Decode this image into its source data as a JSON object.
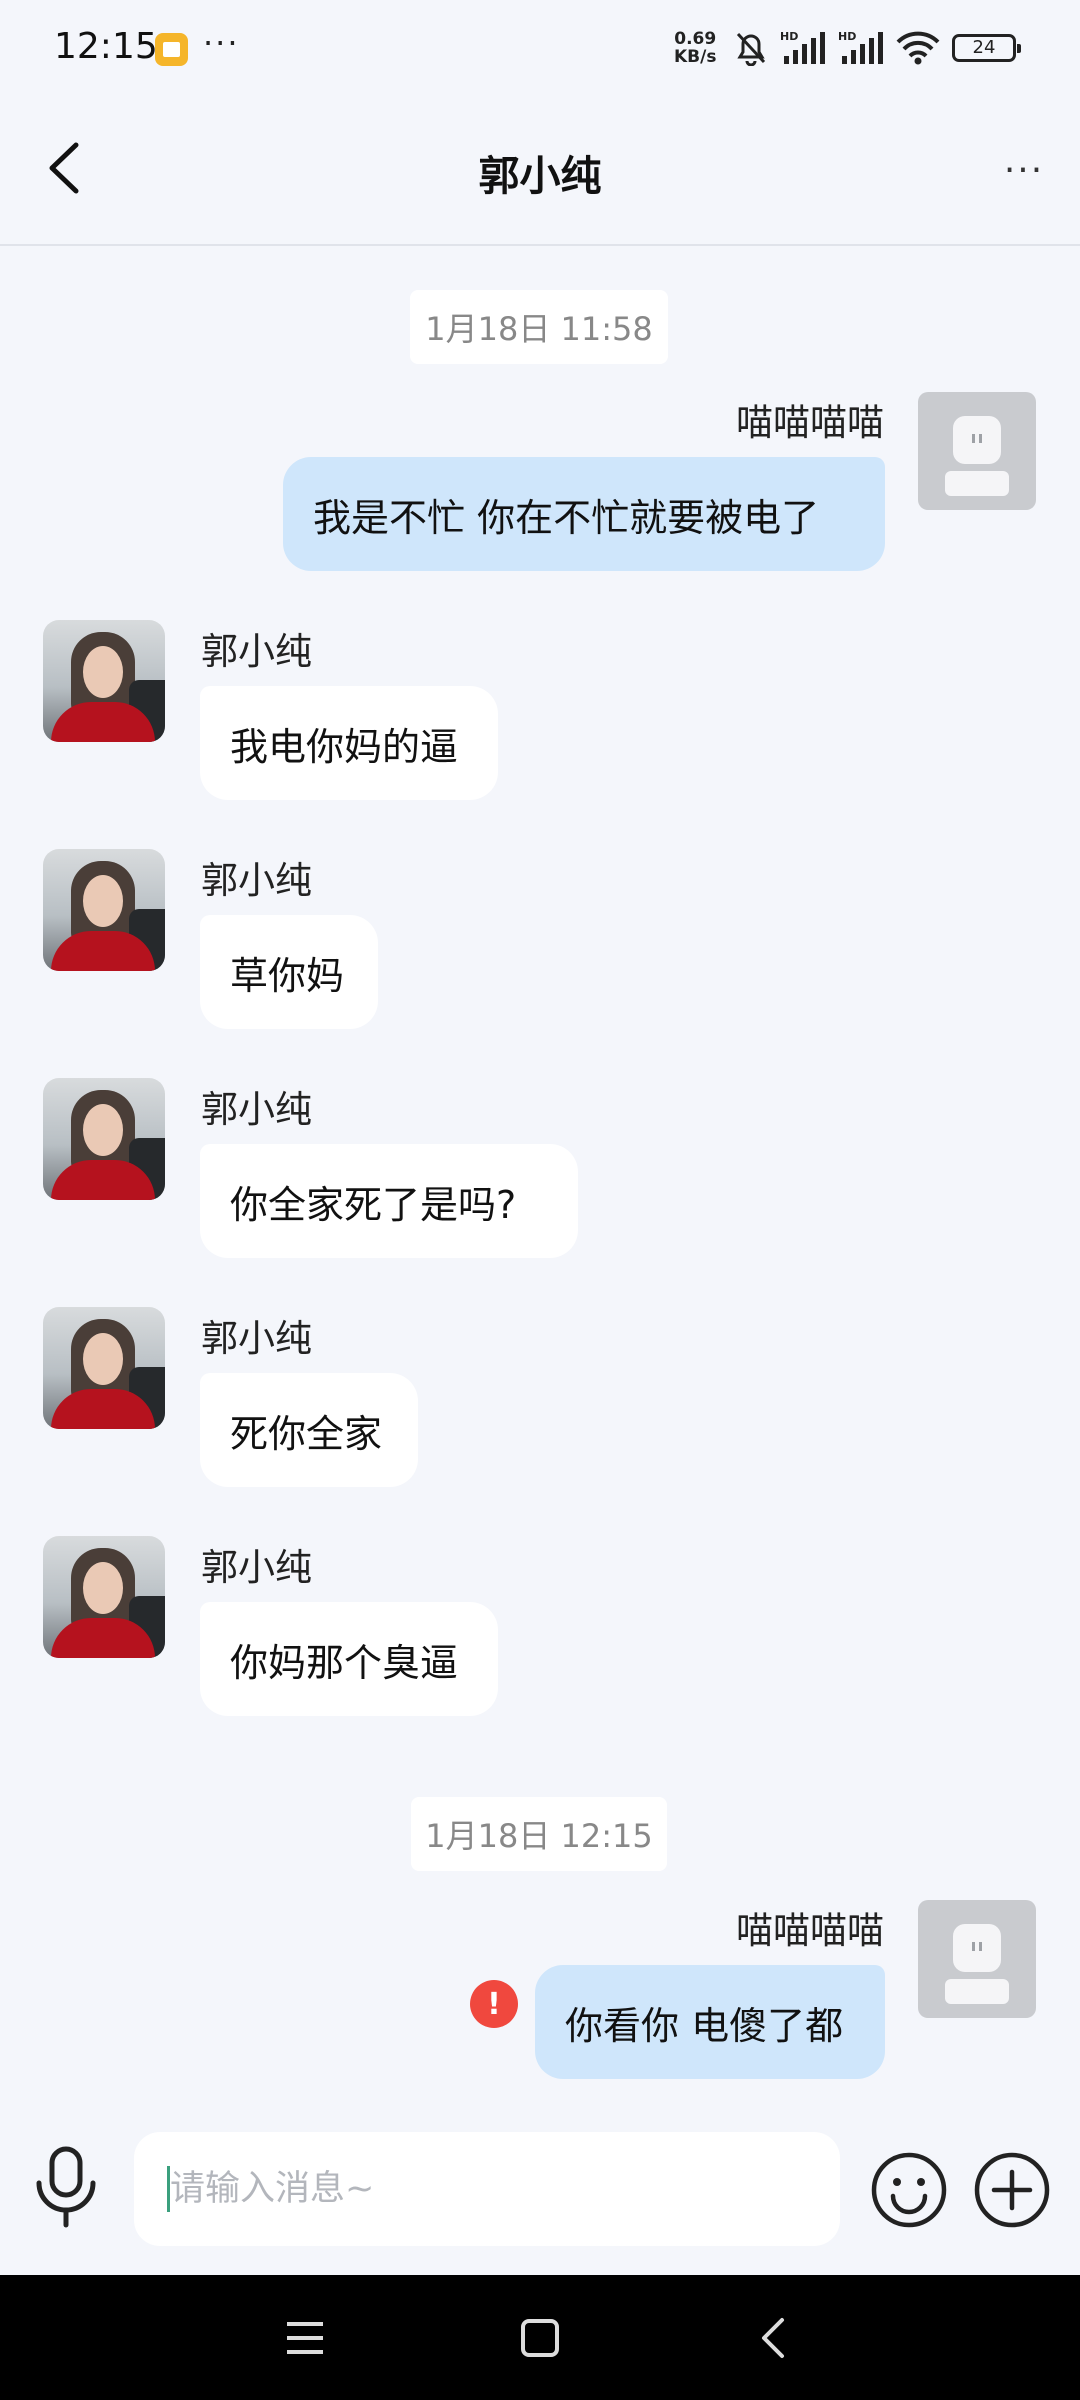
{
  "status_bar": {
    "time": "12:15",
    "net_speed_value": "0.69",
    "net_speed_unit": "KB/s",
    "battery": "24",
    "signal_tag": "HD"
  },
  "header": {
    "title": "郭小纯",
    "more_label": "···"
  },
  "messages": {
    "timestamp_1": "1月18日 11:58",
    "timestamp_2": "1月18日 12:15",
    "self_name": "喵喵喵喵",
    "other_name": "郭小纯",
    "m1": "我是不忙  你在不忙就要被电了",
    "m2": "我电你妈的逼",
    "m3": "草你妈",
    "m4": "你全家死了是吗?",
    "m5": "死你全家",
    "m6": "你妈那个臭逼",
    "m7": "你看你 电傻了都",
    "error_mark": "!"
  },
  "input": {
    "placeholder": "请输入消息~"
  },
  "icons": [
    "back-arrow-icon",
    "mic-icon",
    "emoji-icon",
    "plus-icon",
    "menu-icon",
    "home-icon",
    "nav-back-icon",
    "error-icon"
  ],
  "colors": {
    "background": "#F4F6FB",
    "outgoing_bubble": "#CFE6FB",
    "incoming_bubble": "#FFFFFF",
    "error": "#F0483E"
  }
}
